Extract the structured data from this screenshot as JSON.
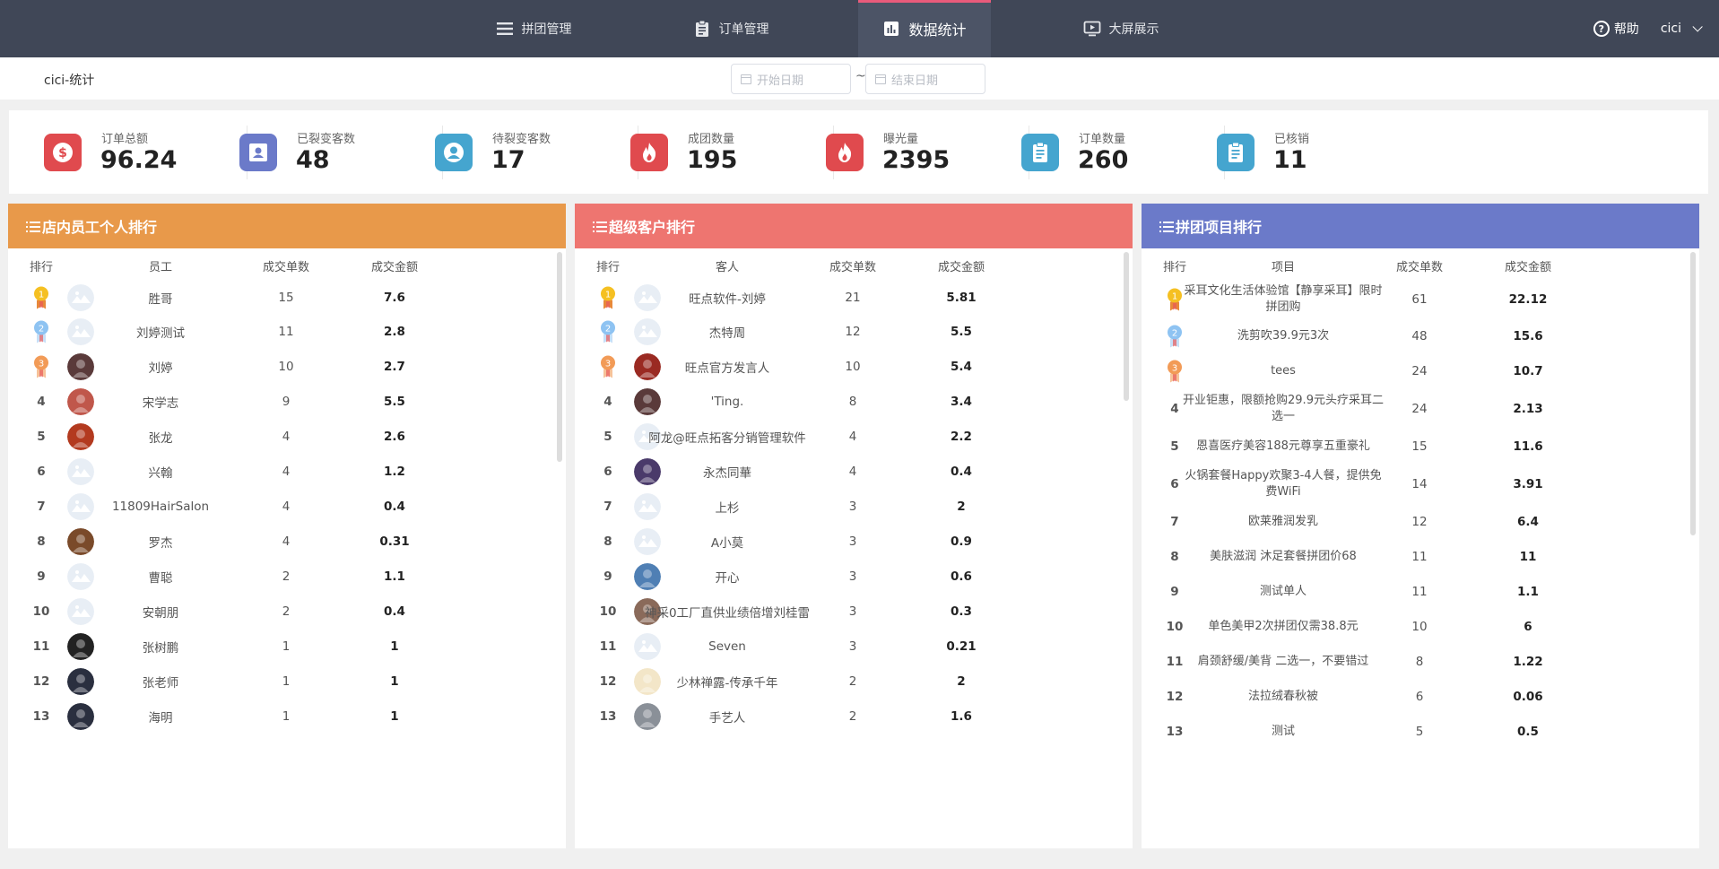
{
  "nav": {
    "items": [
      {
        "label": "拼团管理",
        "icon": "list-icon"
      },
      {
        "label": "订单管理",
        "icon": "clipboard-icon"
      },
      {
        "label": "数据统计",
        "icon": "bar-chart-icon",
        "active": true
      },
      {
        "label": "大屏展示",
        "icon": "screen-play-icon"
      }
    ],
    "help_label": "帮助",
    "user_name": "cici"
  },
  "subheader": {
    "store_title": "cici-统计",
    "start_placeholder": "开始日期",
    "end_placeholder": "结束日期",
    "separator": "~"
  },
  "stats": [
    {
      "label": "订单总额",
      "value": "96.24",
      "color": "#e04a4e",
      "icon": "dollar-icon"
    },
    {
      "label": "已裂变客数",
      "value": "48",
      "color": "#6b7ac9",
      "icon": "contact-card-icon"
    },
    {
      "label": "待裂变客数",
      "value": "17",
      "color": "#45a5cf",
      "icon": "user-circle-icon"
    },
    {
      "label": "成团数量",
      "value": "195",
      "color": "#e04a4e",
      "icon": "fire-icon"
    },
    {
      "label": "曝光量",
      "value": "2395",
      "color": "#e04a4e",
      "icon": "fire-icon"
    },
    {
      "label": "订单数量",
      "value": "260",
      "color": "#45a5cf",
      "icon": "clipboard-icon"
    },
    {
      "label": "已核销",
      "value": "11",
      "color": "#45a5cf",
      "icon": "clipboard-icon"
    }
  ],
  "panels": [
    {
      "title": "店内员工个人排行",
      "color": "#e8994a",
      "headers": [
        "排行",
        "员工",
        "成交单数",
        "成交金额"
      ],
      "rows": [
        {
          "rank": "1",
          "name": "胜哥",
          "count": "15",
          "amount": "7.6",
          "avatar": "#e3eaf2"
        },
        {
          "rank": "2",
          "name": "刘婷测试",
          "count": "11",
          "amount": "2.8",
          "avatar": "#e3eaf2"
        },
        {
          "rank": "3",
          "name": "刘婷",
          "count": "10",
          "amount": "2.7",
          "avatar": "#5a3a3a"
        },
        {
          "rank": "4",
          "name": "宋学志",
          "count": "9",
          "amount": "5.5",
          "avatar": "#c0574b"
        },
        {
          "rank": "5",
          "name": "张龙",
          "count": "4",
          "amount": "2.6",
          "avatar": "#b33a1f"
        },
        {
          "rank": "6",
          "name": "兴翰",
          "count": "4",
          "amount": "1.2",
          "avatar": "#e3eaf2"
        },
        {
          "rank": "7",
          "name": "11809HairSalon",
          "count": "4",
          "amount": "0.4",
          "avatar": "#e3eaf2"
        },
        {
          "rank": "8",
          "name": "罗杰",
          "count": "4",
          "amount": "0.31",
          "avatar": "#7a4a2a"
        },
        {
          "rank": "9",
          "name": "曹聪",
          "count": "2",
          "amount": "1.1",
          "avatar": "#e3eaf2"
        },
        {
          "rank": "10",
          "name": "安朝朋",
          "count": "2",
          "amount": "0.4",
          "avatar": "#e3eaf2"
        },
        {
          "rank": "11",
          "name": "张树鹏",
          "count": "1",
          "amount": "1",
          "avatar": "#222222"
        },
        {
          "rank": "12",
          "name": "张老师",
          "count": "1",
          "amount": "1",
          "avatar": "#2a2f3f"
        },
        {
          "rank": "13",
          "name": "海明",
          "count": "1",
          "amount": "1",
          "avatar": "#2a2f3f"
        }
      ]
    },
    {
      "title": "超级客户排行",
      "color": "#ee7570",
      "headers": [
        "排行",
        "客人",
        "成交单数",
        "成交金额"
      ],
      "rows": [
        {
          "rank": "1",
          "name": "旺点软件-刘婷",
          "count": "21",
          "amount": "5.81",
          "avatar": "#e3eaf2"
        },
        {
          "rank": "2",
          "name": "杰特周",
          "count": "12",
          "amount": "5.5",
          "avatar": "#e3eaf2"
        },
        {
          "rank": "3",
          "name": "旺点官方发言人",
          "count": "10",
          "amount": "5.4",
          "avatar": "#9a2a22"
        },
        {
          "rank": "4",
          "name": "'Ting.",
          "count": "8",
          "amount": "3.4",
          "avatar": "#5a3a3a"
        },
        {
          "rank": "5",
          "name": "阿龙@旺点拓客分销管理软件",
          "count": "4",
          "amount": "2.2",
          "avatar": "#e3eaf2"
        },
        {
          "rank": "6",
          "name": "永杰同華",
          "count": "4",
          "amount": "0.4",
          "avatar": "#4a3a6a"
        },
        {
          "rank": "7",
          "name": "上杉",
          "count": "3",
          "amount": "2",
          "avatar": "#e3eaf2"
        },
        {
          "rank": "8",
          "name": "A小莫",
          "count": "3",
          "amount": "0.9",
          "avatar": "#e3eaf2"
        },
        {
          "rank": "9",
          "name": "开心",
          "count": "3",
          "amount": "0.6",
          "avatar": "#4f7fb4"
        },
        {
          "rank": "10",
          "name": "神采0工厂直供业绩倍增刘桂雷",
          "count": "3",
          "amount": "0.3",
          "avatar": "#8a6a5a"
        },
        {
          "rank": "11",
          "name": "Seven",
          "count": "3",
          "amount": "0.21",
          "avatar": "#e3eaf2"
        },
        {
          "rank": "12",
          "name": "少林禅露-传承千年",
          "count": "2",
          "amount": "2",
          "avatar": "#f3e6c8"
        },
        {
          "rank": "13",
          "name": "手艺人",
          "count": "2",
          "amount": "1.6",
          "avatar": "#8a9098"
        }
      ]
    },
    {
      "title": "拼团项目排行",
      "color": "#6b7ac9",
      "headers": [
        "排行",
        "项目",
        "成交单数",
        "成交金额"
      ],
      "rows": [
        {
          "rank": "1",
          "name": "采耳文化生活体验馆【静享采耳】限时拼团购",
          "count": "61",
          "amount": "22.12"
        },
        {
          "rank": "2",
          "name": "洗剪吹39.9元3次",
          "count": "48",
          "amount": "15.6"
        },
        {
          "rank": "3",
          "name": "tees",
          "count": "24",
          "amount": "10.7"
        },
        {
          "rank": "4",
          "name": "开业钜惠，限额抢购29.9元头疗采耳二选一",
          "count": "24",
          "amount": "2.13"
        },
        {
          "rank": "5",
          "name": "恩喜医疗美容188元尊享五重豪礼",
          "count": "15",
          "amount": "11.6"
        },
        {
          "rank": "6",
          "name": "火锅套餐Happy欢聚3-4人餐，提供免费WiFi",
          "count": "14",
          "amount": "3.91"
        },
        {
          "rank": "7",
          "name": "欧莱雅润发乳",
          "count": "12",
          "amount": "6.4"
        },
        {
          "rank": "8",
          "name": "美肤滋润 沐足套餐拼团价68",
          "count": "11",
          "amount": "11"
        },
        {
          "rank": "9",
          "name": "测试单人",
          "count": "11",
          "amount": "1.1"
        },
        {
          "rank": "10",
          "name": "单色美甲2次拼团仅需38.8元",
          "count": "10",
          "amount": "6"
        },
        {
          "rank": "11",
          "name": "肩颈舒缓/美背 二选一，不要错过",
          "count": "8",
          "amount": "1.22"
        },
        {
          "rank": "12",
          "name": "法拉绒春秋被",
          "count": "6",
          "amount": "0.06"
        },
        {
          "rank": "13",
          "name": "测试",
          "count": "5",
          "amount": "0.5"
        }
      ]
    }
  ]
}
